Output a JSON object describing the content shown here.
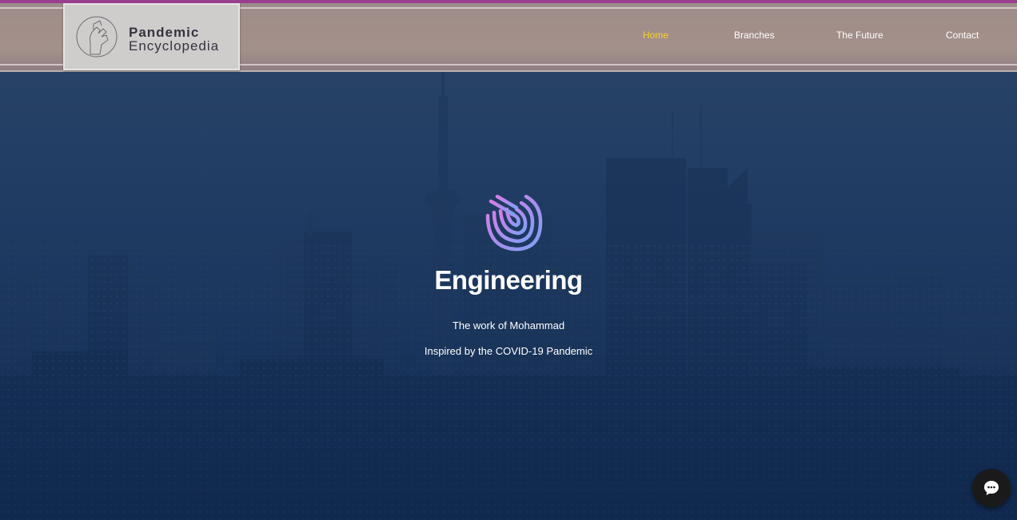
{
  "header": {
    "logo": {
      "title": "Pandemic",
      "subtitle": "Encyclopedia",
      "icon": "hand-sanitizer-icon"
    },
    "nav": [
      {
        "label": "Home",
        "active": true
      },
      {
        "label": "Branches",
        "active": false
      },
      {
        "label": "The Future",
        "active": false
      },
      {
        "label": "Contact",
        "active": false
      }
    ]
  },
  "hero": {
    "icon": "fingerprint-icon",
    "title": "Engineering",
    "lines": [
      "The work of Mohammad",
      "Inspired by the COVID-19 Pandemic"
    ]
  },
  "chat": {
    "icon": "chat-bubble-icon"
  },
  "colors": {
    "active_nav": "#f5d232",
    "header_accent": "#9a3f8f",
    "hero_tint": "#1f3a5e",
    "icon_gradient_start": "#d77de6",
    "icon_gradient_end": "#7f9ff5"
  }
}
